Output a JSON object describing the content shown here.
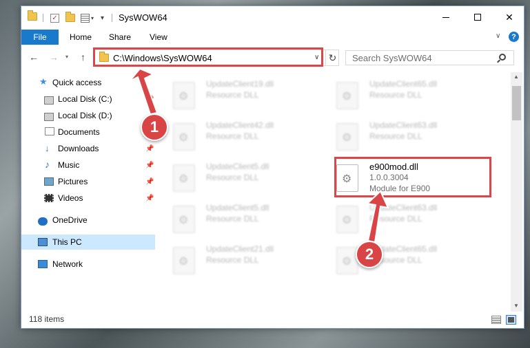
{
  "window": {
    "title": "SysWOW64"
  },
  "ribbon": {
    "tabs": [
      "File",
      "Home",
      "Share",
      "View"
    ]
  },
  "address": {
    "path": "C:\\Windows\\SysWOW64",
    "search_placeholder": "Search SysWOW64"
  },
  "sidebar": {
    "items": [
      {
        "label": "Quick access",
        "icon": "star-icon"
      },
      {
        "label": "Local Disk (C:)",
        "icon": "drive-icon"
      },
      {
        "label": "Local Disk (D:)",
        "icon": "drive-icon"
      },
      {
        "label": "Documents",
        "icon": "documents-icon"
      },
      {
        "label": "Downloads",
        "icon": "downloads-icon"
      },
      {
        "label": "Music",
        "icon": "music-icon"
      },
      {
        "label": "Pictures",
        "icon": "pictures-icon"
      },
      {
        "label": "Videos",
        "icon": "videos-icon"
      },
      {
        "label": "OneDrive",
        "icon": "cloud-icon"
      },
      {
        "label": "This PC",
        "icon": "computer-icon"
      },
      {
        "label": "Network",
        "icon": "network-icon"
      }
    ]
  },
  "files": [
    {
      "name": "UpdateClient19.dll",
      "desc": "Resource DLL"
    },
    {
      "name": "UpdateClient65.dll",
      "desc": "Resource DLL"
    },
    {
      "name": "UpdateClient42.dll",
      "desc": "Resource DLL"
    },
    {
      "name": "UpdateClient63.dll",
      "desc": "Resource DLL"
    },
    {
      "name": "UpdateClient5.dll",
      "desc": "Resource DLL"
    },
    {
      "name": "UpdateClient5.dll",
      "desc": "Resource DLL"
    },
    {
      "name": "UpdateClient63.dll",
      "desc": "Resource DLL"
    },
    {
      "name": "UpdateClient21.dll",
      "desc": "Resource DLL"
    },
    {
      "name": "UpdateClient65.dll",
      "desc": "Resource DLL"
    }
  ],
  "target_file": {
    "name": "e900mod.dll",
    "version": "1.0.0.3004",
    "desc": "Module for E900"
  },
  "status": {
    "count": "118 items"
  },
  "annotations": {
    "step1": "1",
    "step2": "2",
    "color": "#d9474a"
  }
}
